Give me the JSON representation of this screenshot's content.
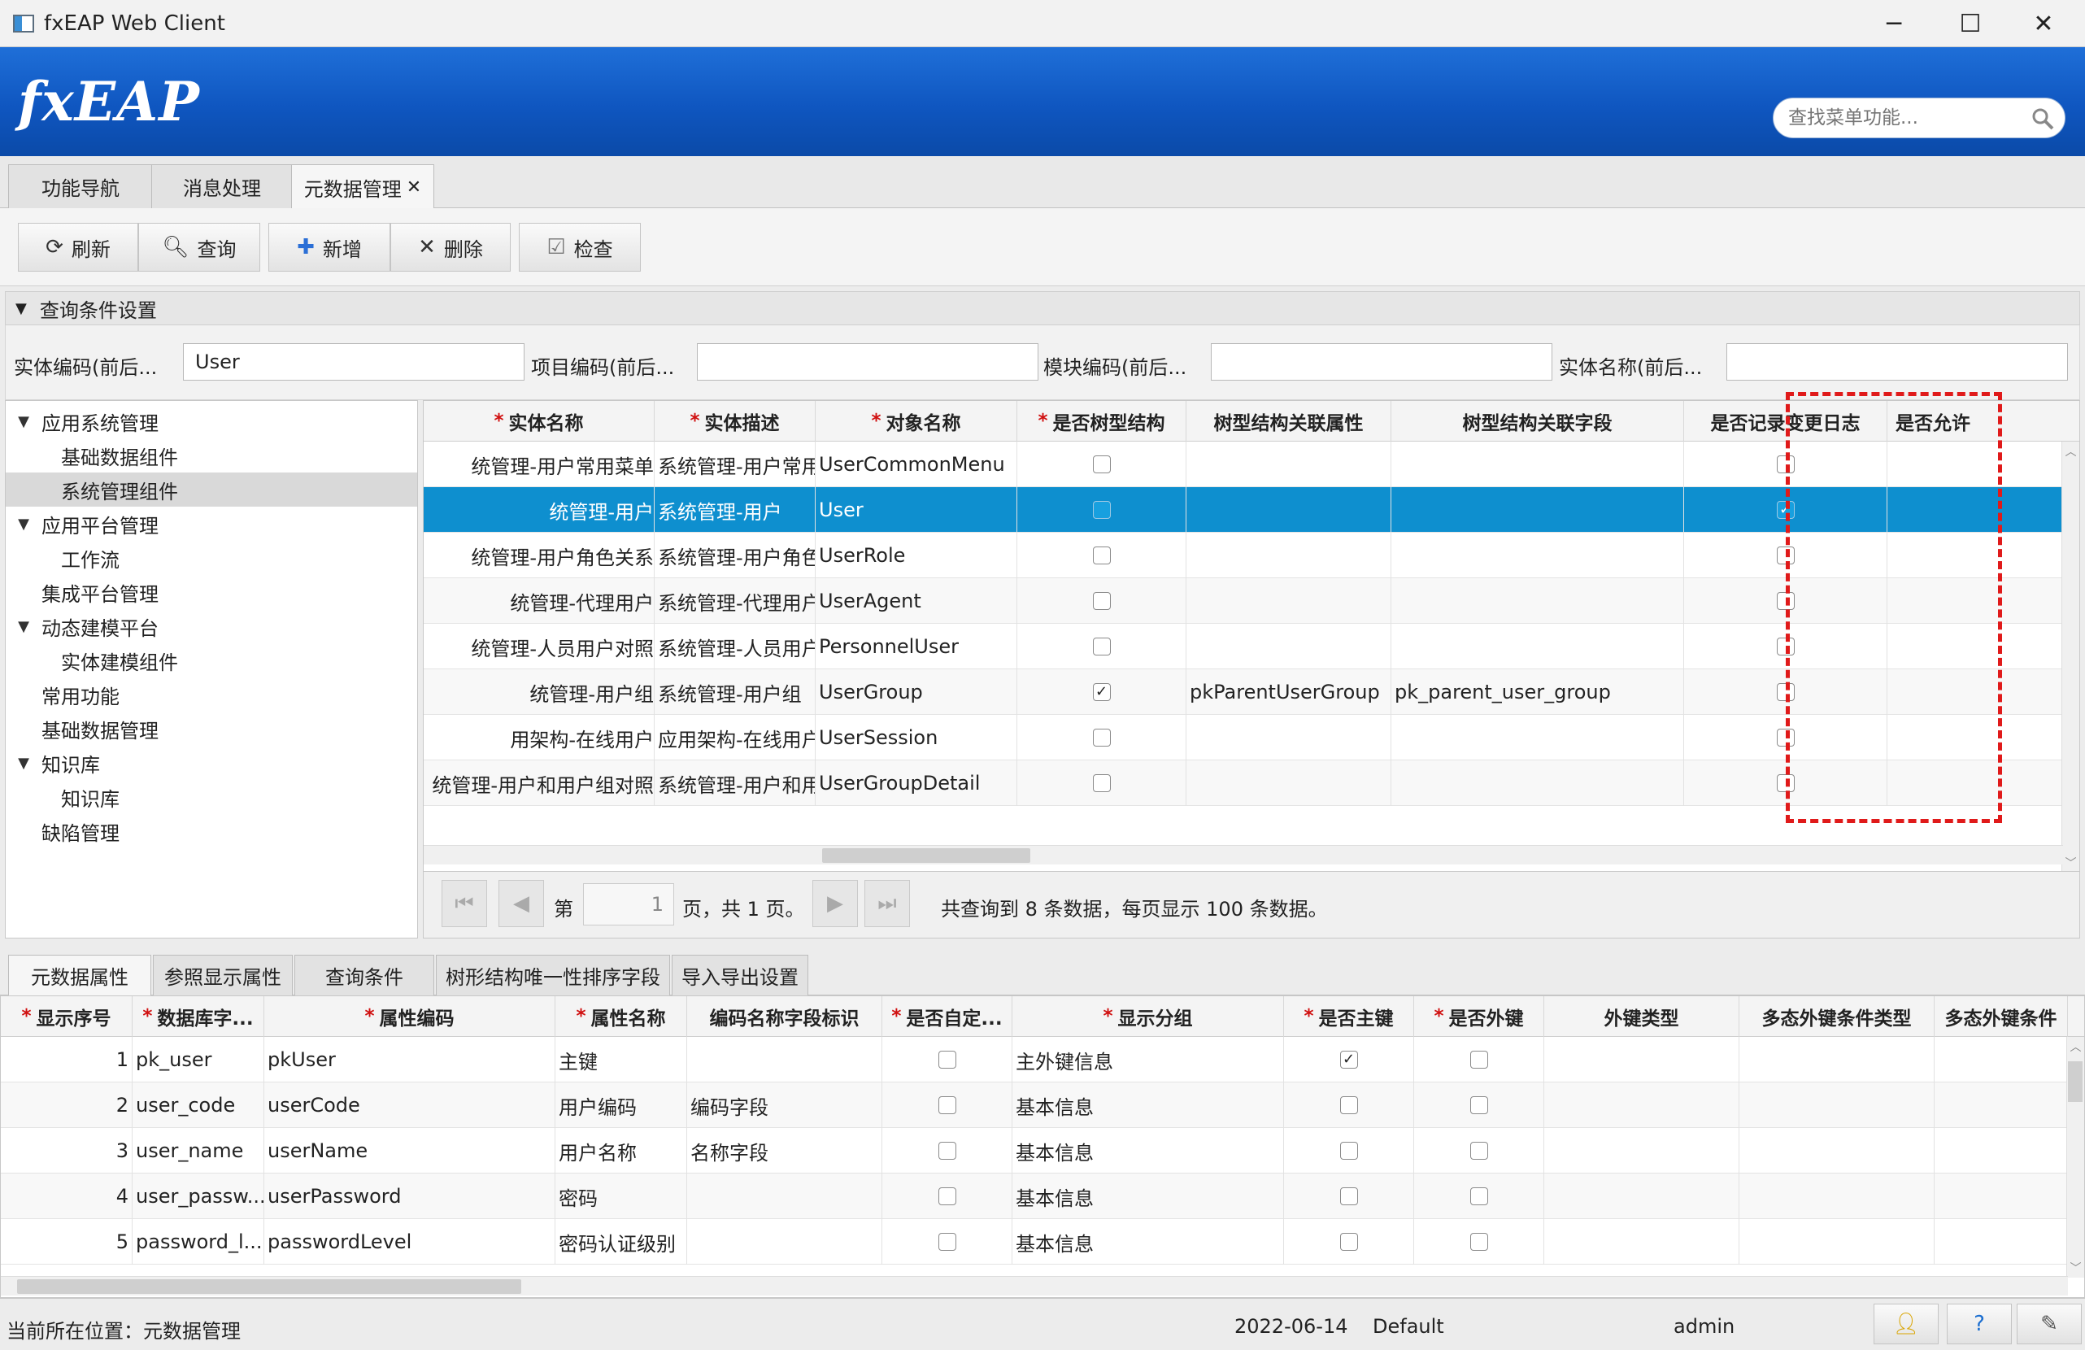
{
  "window": {
    "title": "fxEAP Web Client",
    "minimize": "─",
    "maximize": "☐",
    "close": "✕"
  },
  "header": {
    "logo": "fxEAP",
    "search_placeholder": "查找菜单功能..."
  },
  "main_tabs": [
    {
      "label": "功能导航"
    },
    {
      "label": "消息处理"
    },
    {
      "label": "元数据管理",
      "close": "✕",
      "active": true
    }
  ],
  "toolbar": {
    "refresh": "刷新",
    "query": "查询",
    "add": "新增",
    "delete": "删除",
    "check": "检查"
  },
  "query_panel": {
    "title": "查询条件设置",
    "fields": [
      {
        "label": "实体编码(前后...",
        "value": "User"
      },
      {
        "label": "项目编码(前后...",
        "value": ""
      },
      {
        "label": "模块编码(前后...",
        "value": ""
      },
      {
        "label": "实体名称(前后...",
        "value": ""
      }
    ]
  },
  "tree": [
    {
      "label": "应用系统管理",
      "expanded": true,
      "level": 0
    },
    {
      "label": "基础数据组件",
      "level": 1
    },
    {
      "label": "系统管理组件",
      "level": 1,
      "selected": true
    },
    {
      "label": "应用平台管理",
      "expanded": true,
      "level": 0
    },
    {
      "label": "工作流",
      "level": 1
    },
    {
      "label": "集成平台管理",
      "level": 0
    },
    {
      "label": "动态建模平台",
      "expanded": true,
      "level": 0
    },
    {
      "label": "实体建模组件",
      "level": 1
    },
    {
      "label": "常用功能",
      "level": 0
    },
    {
      "label": "基础数据管理",
      "level": 0
    },
    {
      "label": "知识库",
      "expanded": true,
      "level": 0
    },
    {
      "label": "知识库",
      "level": 1
    },
    {
      "label": "缺陷管理",
      "level": 0
    }
  ],
  "entity_grid": {
    "columns": [
      {
        "label": "实体名称",
        "required": true
      },
      {
        "label": "实体描述",
        "required": true
      },
      {
        "label": "对象名称",
        "required": true
      },
      {
        "label": "是否树型结构",
        "required": true
      },
      {
        "label": "树型结构关联属性",
        "required": false
      },
      {
        "label": "树型结构关联字段",
        "required": false
      },
      {
        "label": "是否记录变更日志",
        "required": false
      },
      {
        "label": "是否允许",
        "required": false
      }
    ],
    "rows": [
      {
        "name": "统管理-用户常用菜单",
        "desc": "系统管理-用户常用菜单",
        "obj": "UserCommonMenu",
        "tree": false,
        "tree_attr": "",
        "tree_field": "",
        "log": false
      },
      {
        "name": "统管理-用户",
        "desc": "系统管理-用户",
        "obj": "User",
        "tree": false,
        "tree_attr": "",
        "tree_field": "",
        "log": true,
        "selected": true
      },
      {
        "name": "统管理-用户角色关系",
        "desc": "系统管理-用户角色关系",
        "obj": "UserRole",
        "tree": false,
        "tree_attr": "",
        "tree_field": "",
        "log": false
      },
      {
        "name": "统管理-代理用户",
        "desc": "系统管理-代理用户",
        "obj": "UserAgent",
        "tree": false,
        "tree_attr": "",
        "tree_field": "",
        "log": false
      },
      {
        "name": "统管理-人员用户对照",
        "desc": "系统管理-人员用户对照",
        "obj": "PersonnelUser",
        "tree": false,
        "tree_attr": "",
        "tree_field": "",
        "log": false
      },
      {
        "name": "统管理-用户组",
        "desc": "系统管理-用户组",
        "obj": "UserGroup",
        "tree": true,
        "tree_attr": "pkParentUserGroup",
        "tree_field": "pk_parent_user_group",
        "log": false
      },
      {
        "name": "用架构-在线用户",
        "desc": "应用架构-在线用户",
        "obj": "UserSession",
        "tree": false,
        "tree_attr": "",
        "tree_field": "",
        "log": false
      },
      {
        "name": "统管理-用户和用户组对照",
        "desc": "系统管理-用户和用户组对照",
        "obj": "UserGroupDetail",
        "tree": false,
        "tree_attr": "",
        "tree_field": "",
        "log": false
      }
    ]
  },
  "pager": {
    "page_prefix": "第",
    "page_value": "1",
    "page_suffix": "页，共 1 页。",
    "summary": "共查询到 8 条数据，每页显示 100 条数据。"
  },
  "bottom_tabs": [
    {
      "label": "元数据属性",
      "active": true
    },
    {
      "label": "参照显示属性"
    },
    {
      "label": "查询条件"
    },
    {
      "label": "树形结构唯一性排序字段"
    },
    {
      "label": "导入导出设置"
    }
  ],
  "attr_grid": {
    "columns": [
      {
        "label": "显示序号",
        "required": true
      },
      {
        "label": "数据库字...",
        "required": true
      },
      {
        "label": "属性编码",
        "required": true
      },
      {
        "label": "属性名称",
        "required": true
      },
      {
        "label": "编码名称字段标识",
        "required": false
      },
      {
        "label": "是否自定...",
        "required": true
      },
      {
        "label": "显示分组",
        "required": true
      },
      {
        "label": "是否主键",
        "required": true
      },
      {
        "label": "是否外键",
        "required": true
      },
      {
        "label": "外键类型",
        "required": false
      },
      {
        "label": "多态外键条件类型",
        "required": false
      },
      {
        "label": "多态外键条件",
        "required": false
      }
    ],
    "rows": [
      {
        "seq": "1",
        "db": "pk_user",
        "code": "pkUser",
        "name": "主键",
        "flag": "",
        "custom": false,
        "group": "主外键信息",
        "pk": true,
        "fk": false
      },
      {
        "seq": "2",
        "db": "user_code",
        "code": "userCode",
        "name": "用户编码",
        "flag": "编码字段",
        "custom": false,
        "group": "基本信息",
        "pk": false,
        "fk": false
      },
      {
        "seq": "3",
        "db": "user_name",
        "code": "userName",
        "name": "用户名称",
        "flag": "名称字段",
        "custom": false,
        "group": "基本信息",
        "pk": false,
        "fk": false
      },
      {
        "seq": "4",
        "db": "user_passw...",
        "code": "userPassword",
        "name": "密码",
        "flag": "",
        "custom": false,
        "group": "基本信息",
        "pk": false,
        "fk": false
      },
      {
        "seq": "5",
        "db": "password_l...",
        "code": "passwordLevel",
        "name": "密码认证级别",
        "flag": "",
        "custom": false,
        "group": "基本信息",
        "pk": false,
        "fk": false
      }
    ]
  },
  "status": {
    "location": "当前所在位置：元数据管理",
    "date": "2022-06-14",
    "theme": "Default",
    "user": "admin"
  },
  "colors": {
    "banner": "#0f56c0",
    "selection": "#0e8fcf",
    "highlight_box": "#e01a1a"
  }
}
